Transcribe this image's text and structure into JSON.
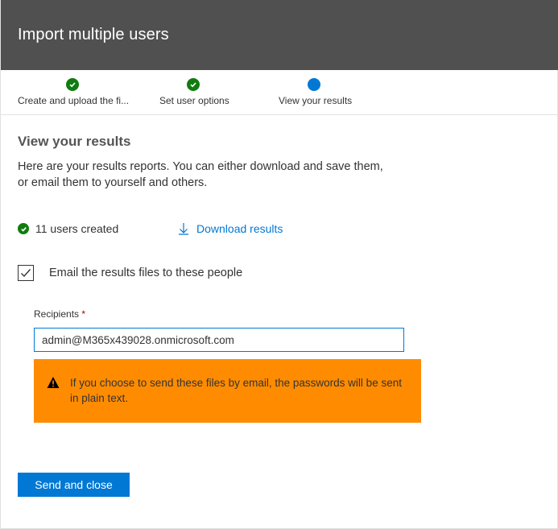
{
  "header": {
    "title": "Import multiple users"
  },
  "steps": [
    {
      "label": "Create and upload the fi...",
      "status": "done"
    },
    {
      "label": "Set user options",
      "status": "done"
    },
    {
      "label": "View your results",
      "status": "current"
    }
  ],
  "main": {
    "section_title": "View your results",
    "intro_line1": "Here are your results reports. You can either download and save them,",
    "intro_line2": "or email them to yourself and others.",
    "created_text": "11 users created",
    "download_label": "Download results",
    "email_checkbox_label": "Email the results files to these people",
    "email_checked": true,
    "recipients_label": "Recipients",
    "required_marker": "*",
    "recipients_value": "admin@M365x439028.onmicrosoft.com",
    "warning_text": "If you choose to send these files by email, the passwords will be sent in plain text.",
    "send_button_label": "Send and close"
  },
  "icons": {
    "step_done": "check-circle-icon",
    "step_current": "current-step-dot-icon",
    "created": "check-circle-icon",
    "download": "download-arrow-icon",
    "checkbox": "checkmark-icon",
    "warning": "warning-triangle-icon"
  },
  "colors": {
    "header_bg": "#505050",
    "accent": "#0078d4",
    "success": "#107c10",
    "warning_bg": "#ff8c00",
    "required": "#a80000"
  }
}
